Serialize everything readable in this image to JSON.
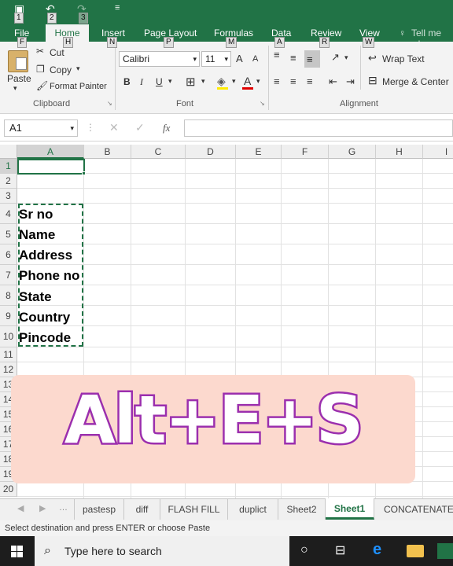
{
  "ribbon_tabs": [
    {
      "label": "File",
      "key": "F"
    },
    {
      "label": "Home",
      "key": "H"
    },
    {
      "label": "Insert",
      "key": "N"
    },
    {
      "label": "Page Layout",
      "key": "P"
    },
    {
      "label": "Formulas",
      "key": "M"
    },
    {
      "label": "Data",
      "key": "A"
    },
    {
      "label": "Review",
      "key": "R"
    },
    {
      "label": "View",
      "key": "W"
    }
  ],
  "tell_me": "Tell me wh",
  "qat_keys": [
    "1",
    "2",
    "3"
  ],
  "clipboard": {
    "paste": "Paste",
    "cut": "Cut",
    "copy": "Copy",
    "format_painter": "Format Painter",
    "label": "Clipboard"
  },
  "font": {
    "name": "Calibri",
    "size": "11",
    "label": "Font",
    "bold": "B",
    "italic": "I",
    "underline": "U",
    "grow": "A",
    "shrink": "A"
  },
  "alignment": {
    "wrap": "Wrap Text",
    "merge": "Merge & Center",
    "label": "Alignment"
  },
  "formula_bar": {
    "name_box": "A1",
    "fx": "fx",
    "value": ""
  },
  "columns": [
    "A",
    "B",
    "C",
    "D",
    "E",
    "F",
    "G",
    "H",
    "I"
  ],
  "rows": [
    "1",
    "2",
    "3",
    "4",
    "5",
    "6",
    "7",
    "8",
    "9",
    "10",
    "11",
    "12",
    "13",
    "14",
    "15",
    "16",
    "17",
    "18",
    "19",
    "20"
  ],
  "cells": [
    {
      "row": "4",
      "value": "Sr no"
    },
    {
      "row": "5",
      "value": "Name"
    },
    {
      "row": "6",
      "value": "Address"
    },
    {
      "row": "7",
      "value": "Phone no"
    },
    {
      "row": "8",
      "value": "State"
    },
    {
      "row": "9",
      "value": "Country"
    },
    {
      "row": "10",
      "value": "Pincode"
    }
  ],
  "overlay_text": "Alt+E+S",
  "sheets": [
    "pastesp",
    "diff",
    "FLASH FILL",
    "duplict",
    "Sheet2",
    "Sheet1",
    "CONCATENATE"
  ],
  "active_sheet": "Sheet1",
  "status": "Select destination and press ENTER or choose Paste",
  "taskbar": {
    "search_placeholder": "Type here to search"
  },
  "colors": {
    "excel_green": "#217346",
    "overlay_bg": "#fcd9ce",
    "overlay_stroke": "#9b2fae"
  }
}
